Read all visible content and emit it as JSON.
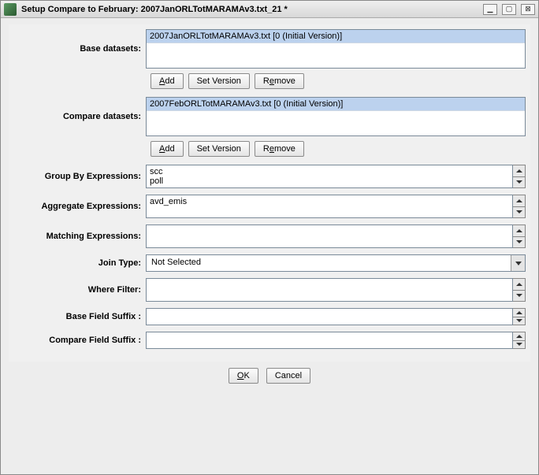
{
  "window": {
    "title": "Setup Compare to February: 2007JanORLTotMARAMAv3.txt_21 *"
  },
  "baseDatasets": {
    "label": "Base datasets:",
    "items": [
      "2007JanORLTotMARAMAv3.txt [0 (Initial Version)]"
    ],
    "btnAdd": "Add",
    "btnSetVersion": "Set Version",
    "btnRemove": "Remove"
  },
  "compareDatasets": {
    "label": "Compare datasets:",
    "items": [
      "2007FebORLTotMARAMAv3.txt [0 (Initial Version)]"
    ],
    "btnAdd": "Add",
    "btnSetVersion": "Set Version",
    "btnRemove": "Remove"
  },
  "groupBy": {
    "label": "Group By Expressions:",
    "value": "scc\npoll"
  },
  "aggregate": {
    "label": "Aggregate Expressions:",
    "value": "avd_emis"
  },
  "matching": {
    "label": "Matching Expressions:",
    "value": ""
  },
  "joinType": {
    "label": "Join Type:",
    "value": "Not Selected"
  },
  "whereFilter": {
    "label": "Where Filter:",
    "value": ""
  },
  "baseSuffix": {
    "label": "Base Field Suffix :",
    "value": ""
  },
  "compareSuffix": {
    "label": "Compare Field Suffix :",
    "value": ""
  },
  "footer": {
    "ok": "OK",
    "cancel": "Cancel"
  }
}
